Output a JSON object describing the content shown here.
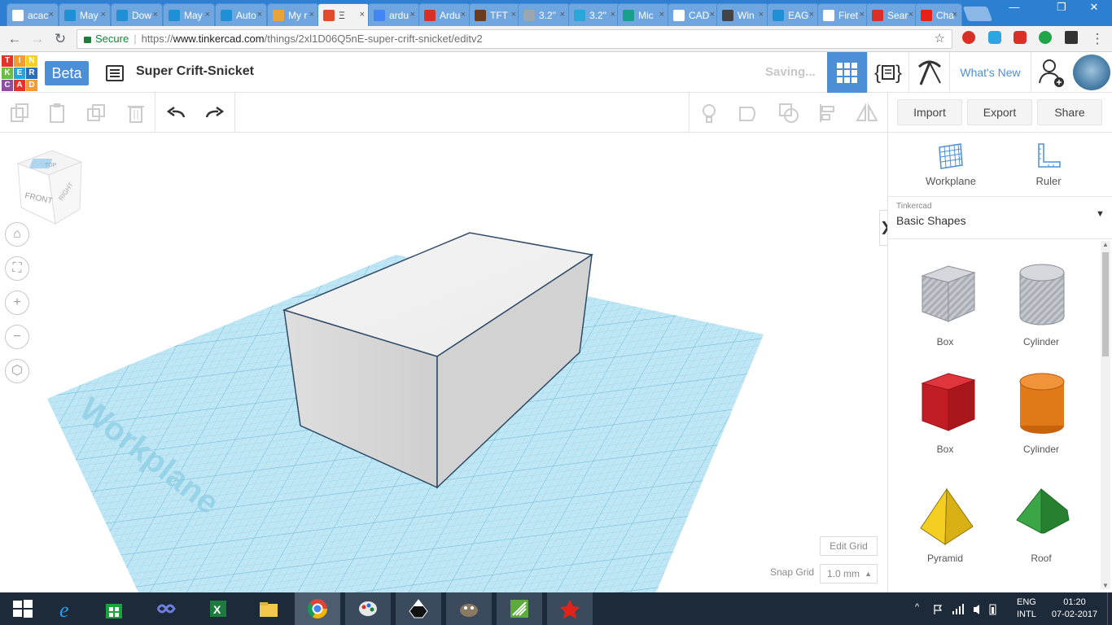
{
  "browser": {
    "tabs": [
      {
        "label": "acac",
        "color": "#ffffff"
      },
      {
        "label": "May",
        "color": "#1f8fd6"
      },
      {
        "label": "Dow",
        "color": "#1f8fd6"
      },
      {
        "label": "May",
        "color": "#1f8fd6"
      },
      {
        "label": "Auto",
        "color": "#1f8fd6"
      },
      {
        "label": "My r",
        "color": "#e8a33a"
      },
      {
        "label": "Ξ",
        "color": "#e24b2b"
      },
      {
        "label": "ardu",
        "color": "#4285f4"
      },
      {
        "label": "Ardu",
        "color": "#d93025"
      },
      {
        "label": "TFT",
        "color": "#6b3b1f"
      },
      {
        "label": "3.2\"",
        "color": "#9aa6b0"
      },
      {
        "label": "3.2\"",
        "color": "#2aa7d6"
      },
      {
        "label": "Mic",
        "color": "#1a9f8f"
      },
      {
        "label": "CAD",
        "color": "#ffffff"
      },
      {
        "label": "Win",
        "color": "#444444"
      },
      {
        "label": "EAG",
        "color": "#1f8fd6"
      },
      {
        "label": "Firet",
        "color": "#ffffff"
      },
      {
        "label": "Sear",
        "color": "#d93025"
      },
      {
        "label": "Cha",
        "color": "#e62117"
      }
    ],
    "window_controls": {
      "minimize": "—",
      "restore": "❐",
      "close": "✕"
    },
    "secure_label": "Secure",
    "url_prefix": "https://",
    "url_domain": "www.tinkercad.com",
    "url_path": "/things/2xl1D06Q5nE-super-crift-snicket/editv2"
  },
  "app": {
    "logo_letters": [
      "T",
      "I",
      "N",
      "K",
      "E",
      "R",
      "C",
      "A",
      "D"
    ],
    "logo_colors": [
      "#e6332a",
      "#f29d2f",
      "#f7d31f",
      "#6cbd45",
      "#21a7d8",
      "#2b6fb6",
      "#8e4fa0",
      "#e6332a",
      "#f29d2f"
    ],
    "beta_label": "Beta",
    "design_title": "Super Crift-Snicket",
    "status_text": "Saving...",
    "whats_new": "What's New",
    "accent": "#4d8fd6"
  },
  "toolbar": {
    "import_label": "Import",
    "export_label": "Export",
    "share_label": "Share"
  },
  "viewcube": {
    "top": "TOP",
    "front": "FRONT",
    "right": "RIGHT"
  },
  "workplane_label": "Workplane",
  "grid": {
    "edit_grid_label": "Edit Grid",
    "snap_grid_label": "Snap Grid",
    "snap_grid_value": "1.0 mm",
    "snap_arrow": "▲",
    "collapse_glyph": "❯"
  },
  "panel": {
    "workplane_label": "Workplane",
    "ruler_label": "Ruler",
    "library_source": "Tinkercad",
    "category": "Basic Shapes",
    "caret": "▼",
    "shapes": [
      {
        "label": "Box",
        "color": "#b9bec6"
      },
      {
        "label": "Cylinder",
        "color": "#b9bec6"
      },
      {
        "label": "Box",
        "color": "#d2232a"
      },
      {
        "label": "Cylinder",
        "color": "#e57916"
      },
      {
        "label": "Pyramid",
        "color": "#f1c515"
      },
      {
        "label": "Roof",
        "color": "#2f9a3a"
      }
    ]
  },
  "taskbar": {
    "lang_top": "ENG",
    "lang_bottom": "INTL",
    "time": "01:20",
    "date": "07-02-2017",
    "tray_arrow": "^"
  }
}
